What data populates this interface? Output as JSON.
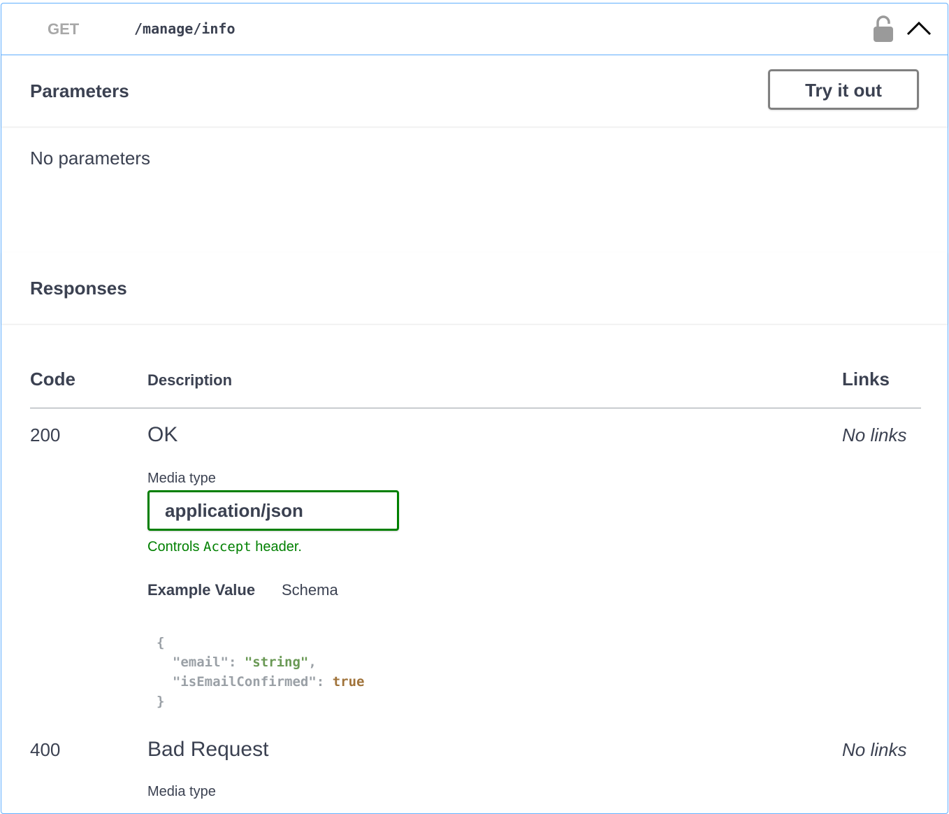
{
  "operation": {
    "method": "GET",
    "path": "/manage/info"
  },
  "parameters": {
    "title": "Parameters",
    "try_label": "Try it out",
    "empty_text": "No parameters"
  },
  "responses": {
    "title": "Responses",
    "columns": {
      "code": "Code",
      "description": "Description",
      "links": "Links"
    },
    "rows": [
      {
        "code": "200",
        "description": "OK",
        "links": "No links",
        "media_label": "Media type",
        "media_value": "application/json",
        "controls_prefix": "Controls",
        "controls_mono": "Accept",
        "controls_suffix": "header.",
        "tab_example": "Example Value",
        "tab_schema": "Schema",
        "example": {
          "open": "{",
          "key1": "\"email\"",
          "sep1": ": ",
          "val1": "\"string\"",
          "comma1": ",",
          "key2": "\"isEmailConfirmed\"",
          "sep2": ": ",
          "val2": "true",
          "close": "}"
        }
      },
      {
        "code": "400",
        "description": "Bad Request",
        "links": "No links",
        "media_label": "Media type"
      }
    ]
  },
  "colors": {
    "accent": "#61affe",
    "success": "#008000",
    "text": "#3b4151"
  },
  "icons": [
    "lock-icon",
    "chevron-up-icon"
  ]
}
